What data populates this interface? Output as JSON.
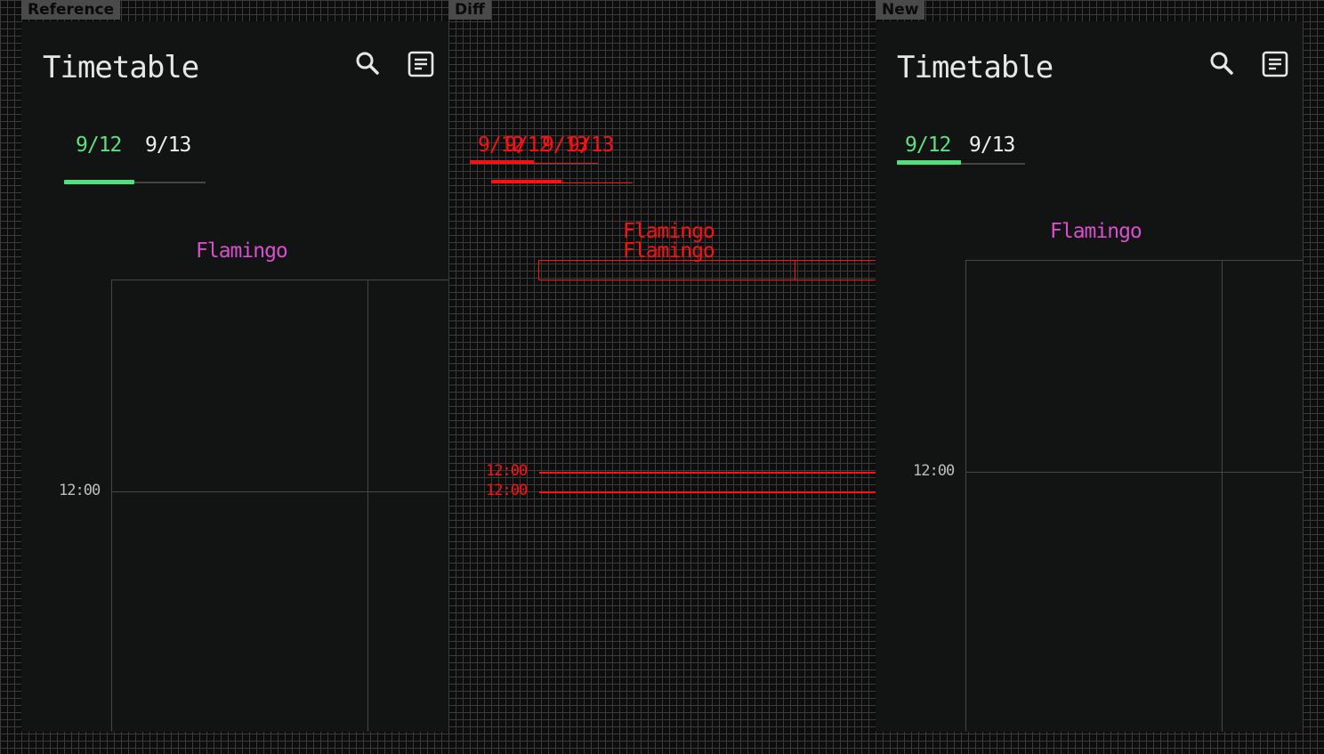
{
  "labels": {
    "reference": "Reference",
    "diff": "Diff",
    "new": "New"
  },
  "app": {
    "title": "Timetable",
    "icons": {
      "search": "search-icon",
      "notes": "notes-icon"
    }
  },
  "tabs": [
    {
      "label": "9/12",
      "active": true
    },
    {
      "label": "9/13",
      "active": false
    }
  ],
  "rooms": [
    "Flamingo"
  ],
  "times": [
    "12:00"
  ],
  "colors": {
    "background": "#111413",
    "accent_green": "#4ee27f",
    "room_pink": "#d84fce",
    "diff_red": "#ff1010",
    "text": "#e6e6e6"
  }
}
